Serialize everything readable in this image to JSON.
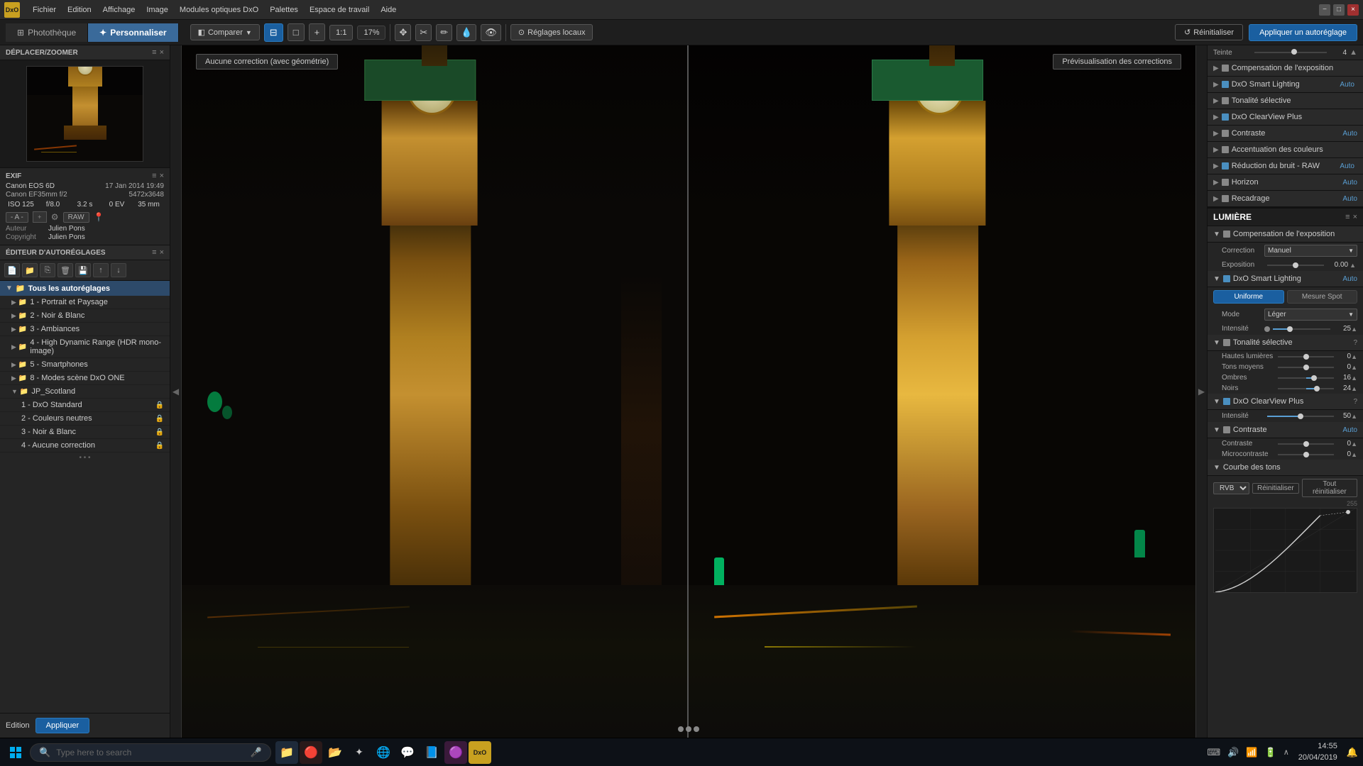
{
  "app": {
    "title": "DxO",
    "logo": "DxO"
  },
  "menubar": {
    "items": [
      "Fichier",
      "Edition",
      "Affichage",
      "Image",
      "Modules optiques DxO",
      "Palettes",
      "Espace de travail",
      "Aide"
    ]
  },
  "header": {
    "tabs": [
      {
        "label": "Photothèque",
        "active": false
      },
      {
        "label": "Personnaliser",
        "active": true
      }
    ],
    "toolbar": {
      "comparer_label": "Comparer",
      "zoom_label": "17%",
      "zoom_fit": "1:1",
      "reglages_label": "Réglages locaux",
      "reinitialiser_label": "Réinitialiser",
      "appliquer_label": "Appliquer un autoréglage"
    }
  },
  "left_panel": {
    "deplacer_title": "DÉPLACER/ZOOMER",
    "exif": {
      "title": "EXIF",
      "camera": "Canon EOS 6D",
      "date": "17 Jan 2014 19:49",
      "lens": "Canon EF35mm f/2",
      "resolution": "5472x3648",
      "iso": "ISO 125",
      "aperture": "f/8.0",
      "shutter": "3.2 s",
      "ev": "0 EV",
      "focal": "35 mm",
      "rating": "- A -",
      "raw_label": "RAW",
      "author_label": "Auteur",
      "author": "Julien Pons",
      "copyright_label": "Copyright",
      "copyright": "Julien Pons"
    },
    "editeur": {
      "title": "ÉDITEUR D'AUTORÉGLAGES",
      "tree": [
        {
          "label": "Tous les autoréglages",
          "level": 0,
          "type": "root",
          "expanded": true
        },
        {
          "label": "1 - Portrait et Paysage",
          "level": 1,
          "expanded": false
        },
        {
          "label": "2 - Noir & Blanc",
          "level": 1,
          "expanded": false
        },
        {
          "label": "3 - Ambiances",
          "level": 1,
          "expanded": false
        },
        {
          "label": "4 - High Dynamic Range (HDR mono-image)",
          "level": 1,
          "expanded": false
        },
        {
          "label": "5 - Smartphones",
          "level": 1,
          "expanded": false
        },
        {
          "label": "8 - Modes scène DxO ONE",
          "level": 1,
          "expanded": false
        },
        {
          "label": "JP_Scotland",
          "level": 1,
          "expanded": true
        },
        {
          "label": "1 - DxO Standard",
          "level": 2,
          "locked": true
        },
        {
          "label": "2 - Couleurs neutres",
          "level": 2,
          "locked": true
        },
        {
          "label": "3 - Noir & Blanc",
          "level": 2,
          "locked": true
        },
        {
          "label": "4 - Aucune correction",
          "level": 2,
          "locked": true
        }
      ]
    },
    "buttons": {
      "edition": "Edition",
      "appliquer": "Appliquer"
    }
  },
  "photo_area": {
    "label_left": "Aucune correction (avec géométrie)",
    "label_right": "Prévisualisation des corrections"
  },
  "right_panel": {
    "reinitialiser": "Réinitialiser",
    "appliquer": "Appliquer un autoréglage",
    "teinte_label": "Teinte",
    "teinte_value": "4",
    "sections": [
      {
        "title": "Compensation de l'exposition",
        "color": "#888",
        "expandable": true,
        "expanded": false
      },
      {
        "title": "DxO Smart Lighting",
        "color": "#4a8fc0",
        "auto": "Auto",
        "expandable": true,
        "expanded": false
      },
      {
        "title": "Tonalité sélective",
        "color": "#888",
        "expandable": true,
        "expanded": false
      },
      {
        "title": "DxO ClearView Plus",
        "color": "#4a8fc0",
        "expandable": true,
        "expanded": false
      },
      {
        "title": "Contraste",
        "color": "#888",
        "auto": "Auto",
        "expandable": true,
        "expanded": false
      },
      {
        "title": "Accentuation des couleurs",
        "color": "#888",
        "expandable": true,
        "expanded": false
      },
      {
        "title": "Réduction du bruit - RAW",
        "color": "#4a8fc0",
        "auto": "Auto",
        "expandable": true
      },
      {
        "title": "Horizon",
        "color": "#888",
        "auto": "Auto",
        "expandable": true
      },
      {
        "title": "Recadrage",
        "color": "#888",
        "auto": "Auto",
        "expandable": true
      }
    ],
    "lumiere": {
      "title": "LUMIÈRE",
      "compensation_title": "Compensation de l'exposition",
      "correction_label": "Correction",
      "correction_value": "Manuel",
      "exposition_label": "Exposition",
      "exposition_value": "0.00",
      "smart_lighting_title": "DxO Smart Lighting",
      "smart_lighting_auto": "Auto",
      "tab_uniform": "Uniforme",
      "tab_mesure": "Mesure Spot",
      "mode_label": "Mode",
      "mode_value": "Léger",
      "intensite_label": "Intensité",
      "intensite_value": "25",
      "tonalite_title": "Tonalité sélective",
      "hautes_lumieres_label": "Hautes lumières",
      "hautes_lumieres_value": "0",
      "tons_moyens_label": "Tons moyens",
      "tons_moyens_value": "0",
      "ombres_label": "Ombres",
      "ombres_value": "16",
      "noirs_label": "Noirs",
      "noirs_value": "24",
      "clearview_title": "DxO ClearView Plus",
      "clearview_intensite_label": "Intensité",
      "clearview_intensite_value": "50",
      "contraste_title": "Contraste",
      "contraste_auto": "Auto",
      "contraste_label": "Contraste",
      "contraste_value": "0",
      "microcontraste_label": "Microcontraste",
      "microcontraste_value": "0",
      "courbe_title": "Courbe des tons",
      "courbe_rvb": "RVB",
      "courbe_reinit": "Réinitialiser",
      "courbe_tout_reinit": "Tout réinitialiser",
      "courbe_max": "255"
    }
  },
  "taskbar": {
    "search_placeholder": "Type here to search",
    "time": "14:55",
    "date": "20/04/2019",
    "icons": [
      "⊞",
      "📁",
      "🔴",
      "📁",
      "🔮",
      "🌐",
      "💬",
      "📘",
      "🟣"
    ],
    "sys_icons": [
      "⌨",
      "🔊",
      "📶",
      "🔋"
    ]
  }
}
